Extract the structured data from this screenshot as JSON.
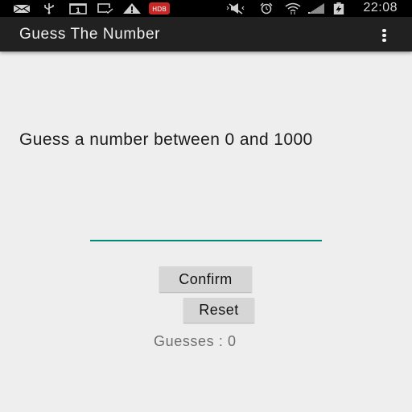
{
  "status_bar": {
    "time": "22:08",
    "icons": [
      "email-icon",
      "usb-icon",
      "calendar-1-icon",
      "task-check-icon",
      "warning-icon",
      "hdb-app-icon",
      "mute-icon",
      "alarm-icon",
      "wifi-icon",
      "signal-icon",
      "battery-charging-icon"
    ],
    "calendar_day": "1",
    "hdb_label": "HDB"
  },
  "app_bar": {
    "title": "Guess The Number",
    "overflow_icon": "more-vert-icon"
  },
  "main": {
    "prompt": "Guess a number between 0 and 1000",
    "input": {
      "value": "",
      "placeholder": ""
    },
    "confirm_label": "Confirm",
    "reset_label": "Reset",
    "guesses_text": "Guesses : 0"
  },
  "colors": {
    "accent": "#00897b",
    "app_bar": "#212121",
    "background": "#eeeeee",
    "button": "#d6d6d6"
  }
}
